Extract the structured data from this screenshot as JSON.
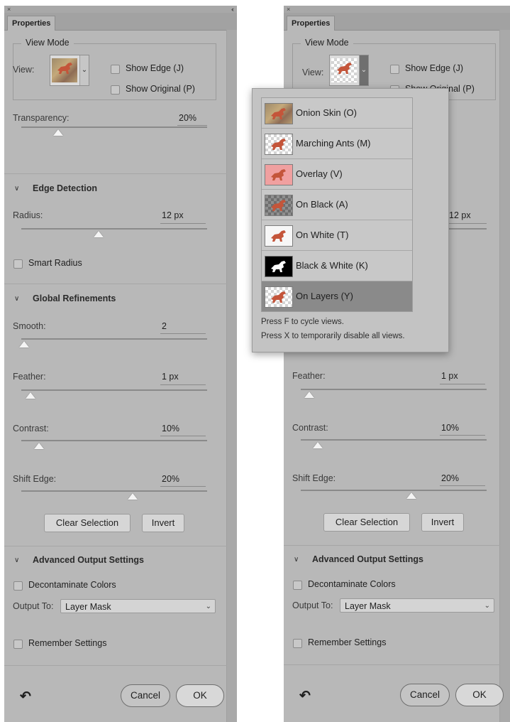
{
  "panel": {
    "tab_title": "Properties",
    "close_glyph": "×",
    "collapse_glyph": "‹‹",
    "view_mode": {
      "legend": "View Mode",
      "view_label": "View:",
      "show_edge_label": "Show Edge (J)",
      "show_original_label": "Show Original (P)"
    },
    "transparency": {
      "label": "Transparency:",
      "value": "20%",
      "level_percent": 20
    },
    "edge_detection": {
      "title": "Edge Detection",
      "radius_label": "Radius:",
      "radius_value": "12 px",
      "smart_radius_label": "Smart Radius"
    },
    "global_refinements": {
      "title": "Global Refinements",
      "smooth": {
        "label": "Smooth:",
        "value": "2"
      },
      "feather": {
        "label": "Feather:",
        "value": "1 px"
      },
      "contrast": {
        "label": "Contrast:",
        "value": "10%"
      },
      "shift_edge": {
        "label": "Shift Edge:",
        "value": "20%"
      },
      "clear_selection_label": "Clear Selection",
      "invert_label": "Invert"
    },
    "advanced_output": {
      "title": "Advanced Output Settings",
      "decontaminate_label": "Decontaminate Colors",
      "output_to_label": "Output To:",
      "output_to_value": "Layer Mask"
    },
    "remember_settings_label": "Remember Settings",
    "reset_glyph": "↶",
    "cancel_label": "Cancel",
    "ok_label": "OK"
  },
  "view_popup": {
    "items": [
      {
        "label": "Onion Skin (O)",
        "thumb": "onion"
      },
      {
        "label": "Marching Ants (M)",
        "thumb": "checker"
      },
      {
        "label": "Overlay (V)",
        "thumb": "overlay"
      },
      {
        "label": "On Black (A)",
        "thumb": "black"
      },
      {
        "label": "On White (T)",
        "thumb": "white"
      },
      {
        "label": "Black & White (K)",
        "thumb": "bw"
      },
      {
        "label": "On Layers (Y)",
        "thumb": "checker",
        "selected": true
      }
    ],
    "hint_cycle": "Press F to cycle views.",
    "hint_disable": "Press X to temporarily disable all views."
  },
  "colors": {
    "panel_bg": "#b8b8b8",
    "selected_item_bg": "#8a8a8a",
    "popup_bg": "#c3c3c3"
  }
}
